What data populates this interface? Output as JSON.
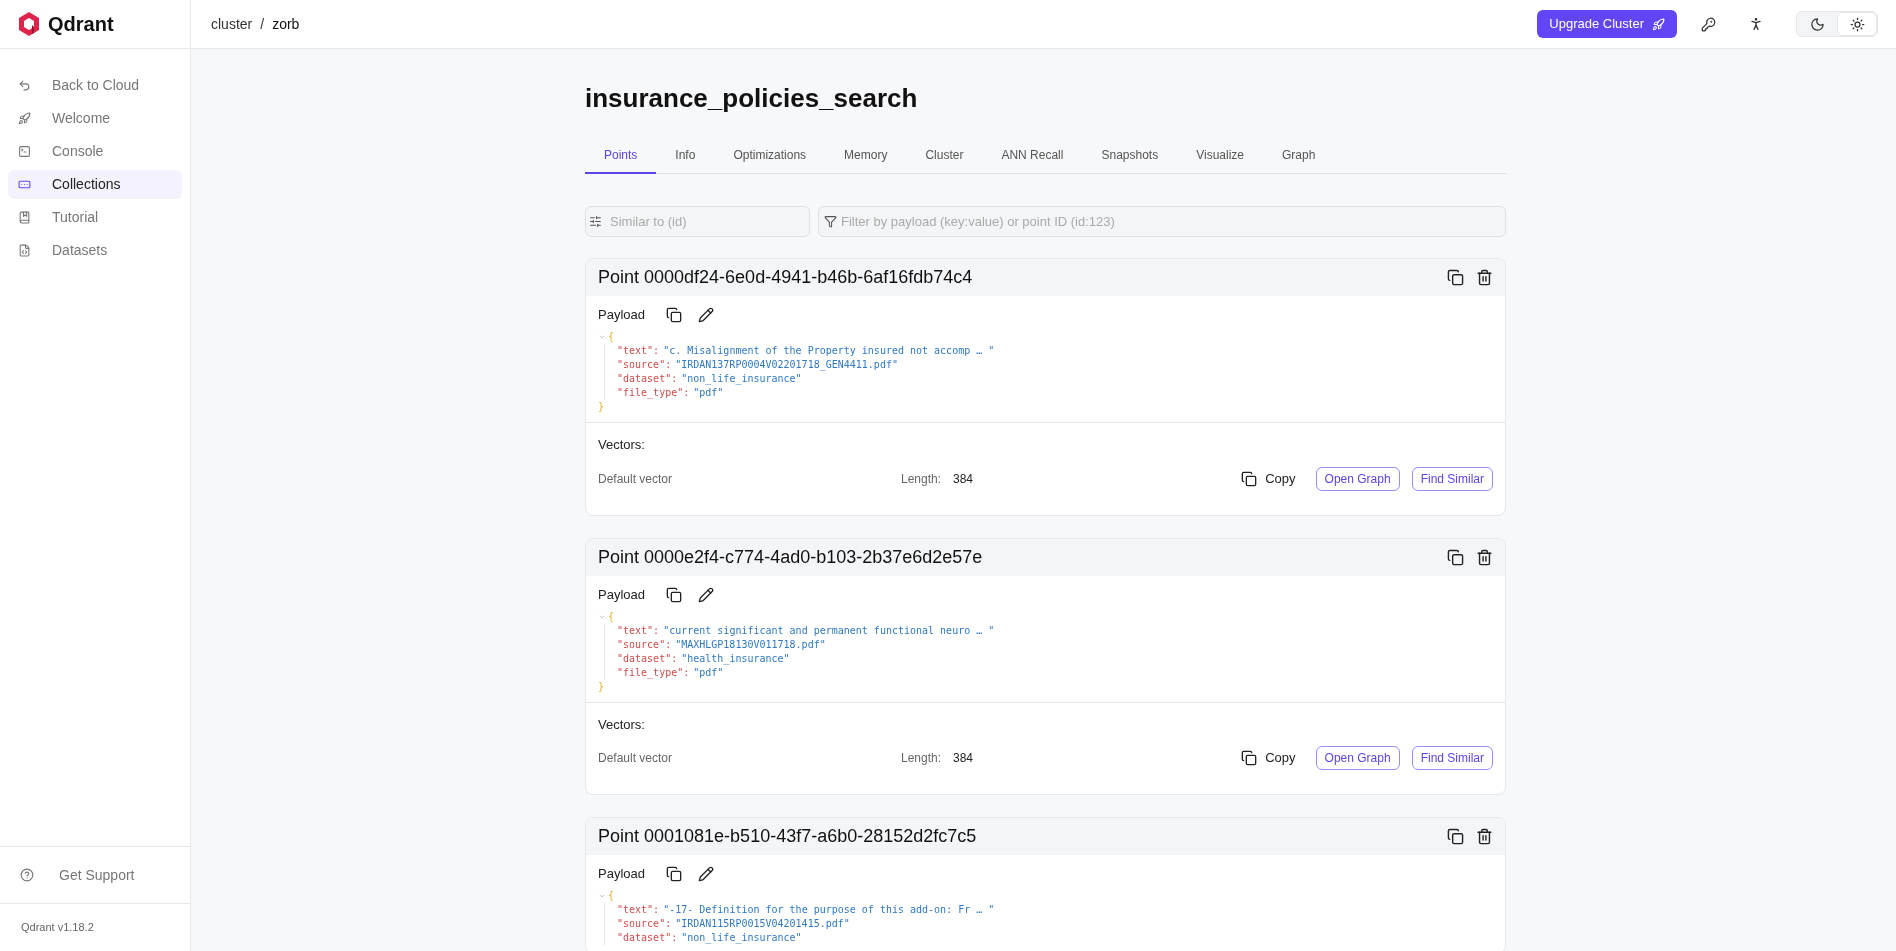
{
  "brand": {
    "name": "Qdrant"
  },
  "breadcrumb": [
    {
      "label": "cluster",
      "current": false
    },
    {
      "label": "zorb",
      "current": true
    }
  ],
  "breadcrumb_separator": "/",
  "header": {
    "upgrade_button": "Upgrade Cluster",
    "theme_toggle": [
      {
        "kind": "dark",
        "selected": false
      },
      {
        "kind": "light",
        "selected": true
      }
    ]
  },
  "sidebar": {
    "items": [
      {
        "kind": "back",
        "label": "Back to Cloud",
        "selected": false
      },
      {
        "kind": "welcome",
        "label": "Welcome",
        "selected": false
      },
      {
        "kind": "console",
        "label": "Console",
        "selected": false
      },
      {
        "kind": "collections",
        "label": "Collections",
        "selected": true
      },
      {
        "kind": "tutorial",
        "label": "Tutorial",
        "selected": false
      },
      {
        "kind": "datasets",
        "label": "Datasets",
        "selected": false
      }
    ],
    "support": "Get Support",
    "version": "Qdrant v1.18.2"
  },
  "page": {
    "title": "insurance_policies_search"
  },
  "tabs": [
    {
      "label": "Points",
      "selected": true
    },
    {
      "label": "Info",
      "selected": false
    },
    {
      "label": "Optimizations",
      "selected": false
    },
    {
      "label": "Memory",
      "selected": false
    },
    {
      "label": "Cluster",
      "selected": false
    },
    {
      "label": "ANN Recall",
      "selected": false
    },
    {
      "label": "Snapshots",
      "selected": false
    },
    {
      "label": "Visualize",
      "selected": false
    },
    {
      "label": "Graph",
      "selected": false
    }
  ],
  "search": {
    "similar_placeholder": "Similar to (id)",
    "filter_placeholder": "Filter by payload (key:value) or point ID (id:123)"
  },
  "points": [
    {
      "title": "Point 0000df24-6e0d-4941-b46b-6af16fdb74c4",
      "payload_label": "Payload",
      "open_brace": "{",
      "close_brace": "}",
      "payload": [
        {
          "key": "\"text\":",
          "value": "\"c. Misalignment of the Property insured not accomp … \""
        },
        {
          "key": "\"source\":",
          "value": "\"IRDAN137RP0004V02201718_GEN4411.pdf\""
        },
        {
          "key": "\"dataset\":",
          "value": "\"non_life_insurance\""
        },
        {
          "key": "\"file_type\":",
          "value": "\"pdf\""
        }
      ],
      "vectors_label": "Vectors:",
      "vectors": [
        {
          "name": "Default vector",
          "length_label": "Length:",
          "length": "384",
          "copy": "Copy",
          "open_graph": "Open Graph",
          "find_similar": "Find Similar"
        }
      ]
    },
    {
      "title": "Point 0000e2f4-c774-4ad0-b103-2b37e6d2e57e",
      "payload_label": "Payload",
      "open_brace": "{",
      "close_brace": "}",
      "payload": [
        {
          "key": "\"text\":",
          "value": "\"current significant and permanent functional neuro … \""
        },
        {
          "key": "\"source\":",
          "value": "\"MAXHLGP18130V011718.pdf\""
        },
        {
          "key": "\"dataset\":",
          "value": "\"health_insurance\""
        },
        {
          "key": "\"file_type\":",
          "value": "\"pdf\""
        }
      ],
      "vectors_label": "Vectors:",
      "vectors": [
        {
          "name": "Default vector",
          "length_label": "Length:",
          "length": "384",
          "copy": "Copy",
          "open_graph": "Open Graph",
          "find_similar": "Find Similar"
        }
      ]
    },
    {
      "title": "Point 0001081e-b510-43f7-a6b0-28152d2fc7c5",
      "payload_label": "Payload",
      "open_brace": "{",
      "payload": [
        {
          "key": "\"text\":",
          "value": "\"-17- Definition for the purpose of this add-on: Fr … \""
        },
        {
          "key": "\"source\":",
          "value": "\"IRDAN115RP0015V04201415.pdf\""
        },
        {
          "key": "\"dataset\":",
          "value": "\"non_life_insurance\""
        }
      ]
    }
  ]
}
